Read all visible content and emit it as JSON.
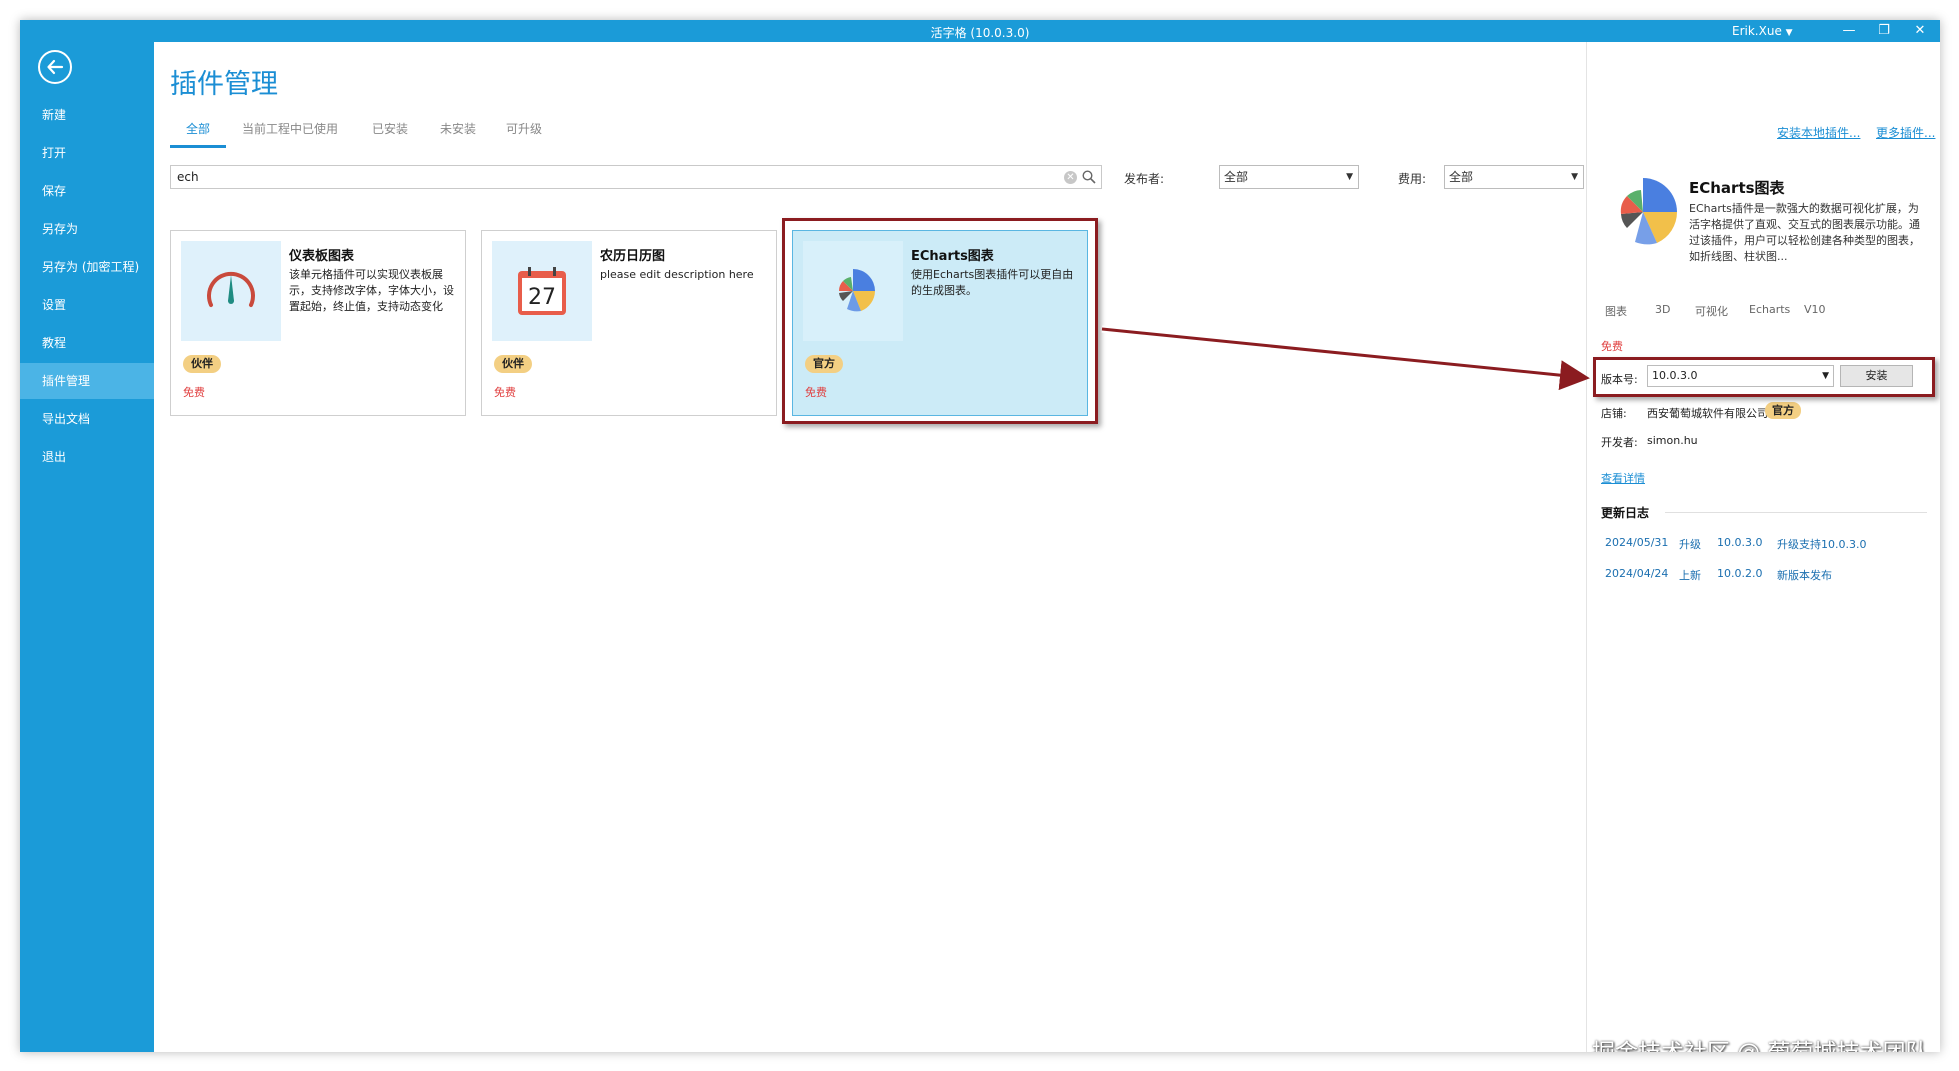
{
  "window": {
    "title": "活字格 (10.0.3.0)",
    "user": "Erik.Xue",
    "minimize": "—",
    "restore": "❐",
    "close": "✕"
  },
  "sidebar": {
    "items": [
      {
        "label": "新建"
      },
      {
        "label": "打开"
      },
      {
        "label": "保存"
      },
      {
        "label": "另存为"
      },
      {
        "label": "另存为 (加密工程)"
      },
      {
        "label": "设置"
      },
      {
        "label": "教程"
      },
      {
        "label": "插件管理",
        "active": true
      },
      {
        "label": "导出文档"
      },
      {
        "label": "退出"
      }
    ]
  },
  "header": {
    "title": "插件管理",
    "tabs": [
      {
        "label": "全部",
        "active": true
      },
      {
        "label": "当前工程中已使用"
      },
      {
        "label": "已安装"
      },
      {
        "label": "未安装"
      },
      {
        "label": "可升级"
      }
    ],
    "links": {
      "install_local": "安装本地插件...",
      "more_plugins": "更多插件..."
    }
  },
  "search": {
    "value": "ech"
  },
  "filters": {
    "publisher_label": "发布者:",
    "publisher_value": "全部",
    "fee_label": "费用:",
    "fee_value": "全部"
  },
  "plugins": [
    {
      "title": "仪表板图表",
      "description": "该单元格插件可以实现仪表板展示，支持修改字体，字体大小，设置起始，终止值，支持动态变化",
      "badge": "伙伴",
      "fee": "免费",
      "icon": "gauge-icon"
    },
    {
      "title": "农历日历图",
      "description": "please edit description here",
      "badge": "伙伴",
      "fee": "免费",
      "icon": "calendar-icon",
      "icon_text": "27"
    },
    {
      "title": "ECharts图表",
      "description": "使用Echarts图表插件可以更自由的生成图表。",
      "badge": "官方",
      "fee": "免费",
      "icon": "echarts-icon",
      "selected": true
    }
  ],
  "detail": {
    "title": "ECharts图表",
    "description": "ECharts插件是一款强大的数据可视化扩展，为活字格提供了直观、交互式的图表展示功能。通过该插件，用户可以轻松创建各种类型的图表，如折线图、柱状图...",
    "tags": [
      "图表",
      "3D",
      "可视化",
      "Echarts",
      "V10"
    ],
    "fee": "免费",
    "version_label": "版本号:",
    "version_value": "10.0.3.0",
    "install_label": "安装",
    "shop_label": "店铺:",
    "shop_value": "西安葡萄城软件有限公司",
    "shop_badge": "官方",
    "developer_label": "开发者:",
    "developer_value": "simon.hu",
    "view_details": "查看详情",
    "changelog_title": "更新日志",
    "changelog": [
      {
        "date": "2024/05/31",
        "type": "升级",
        "version": "10.0.3.0",
        "note": "升级支持10.0.3.0"
      },
      {
        "date": "2024/04/24",
        "type": "上新",
        "version": "10.0.2.0",
        "note": "新版本发布"
      }
    ]
  },
  "watermark": "掘金技术社区 @ 葡萄城技术团队",
  "colors": {
    "brand": "#1b9bd8",
    "accent": "#1b8ed4",
    "annotation": "#8b1c20",
    "fee": "#e04040",
    "badge": "#f3cf83"
  }
}
